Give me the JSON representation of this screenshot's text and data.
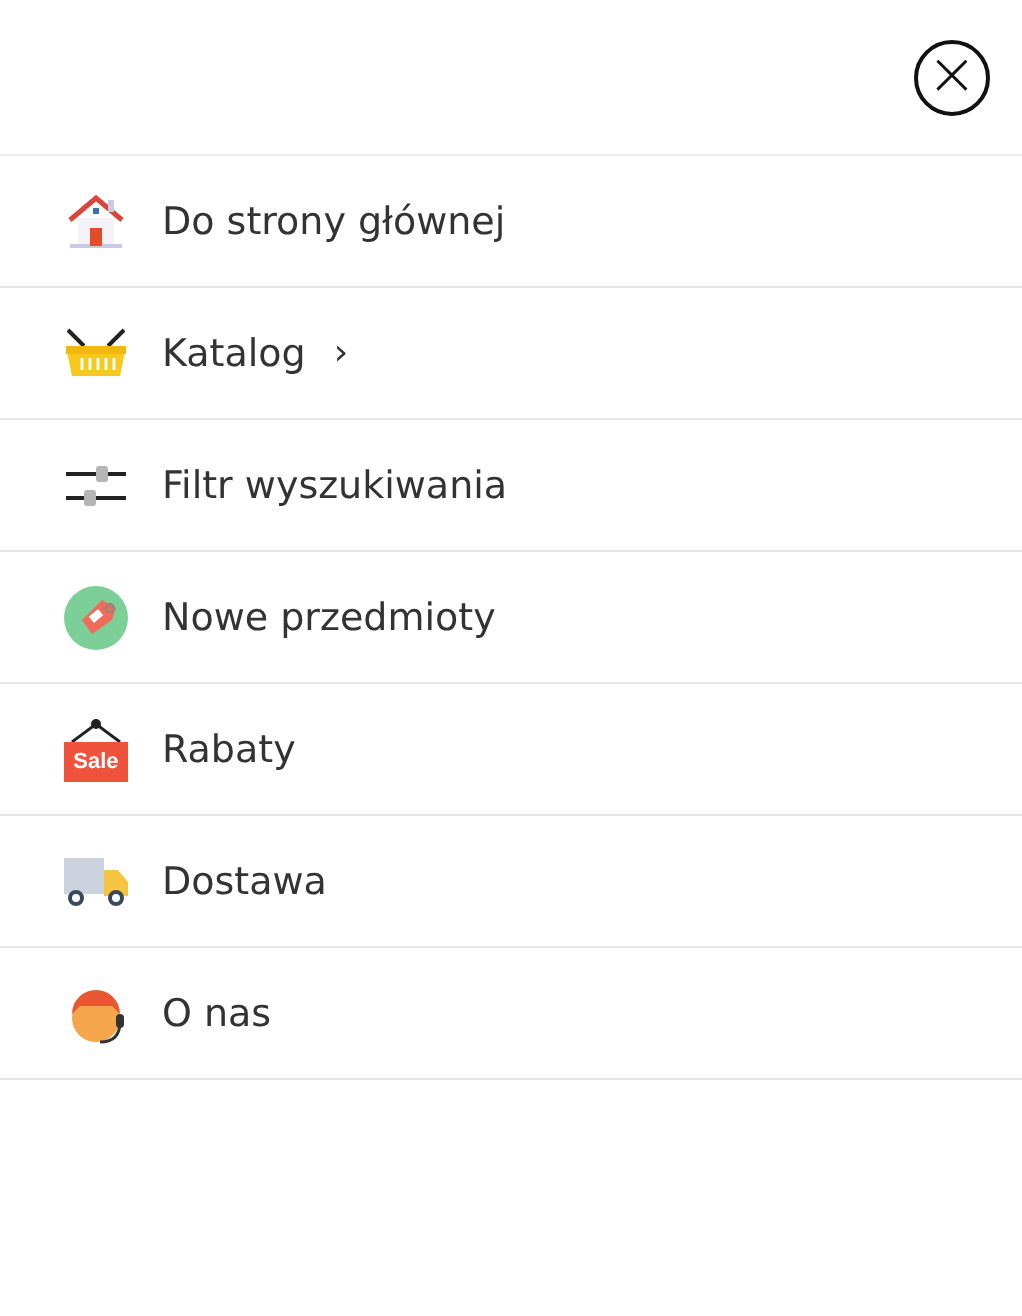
{
  "close_button": {
    "glyph": "×"
  },
  "menu": [
    {
      "label": "Do strony głównej"
    },
    {
      "label": "Katalog",
      "chevron": "›"
    },
    {
      "label": "Filtr wyszukiwania"
    },
    {
      "label": "Nowe przedmioty"
    },
    {
      "label": "Rabaty",
      "icon_text": "Sale"
    },
    {
      "label": "Dostawa"
    },
    {
      "label": "O nas"
    }
  ]
}
